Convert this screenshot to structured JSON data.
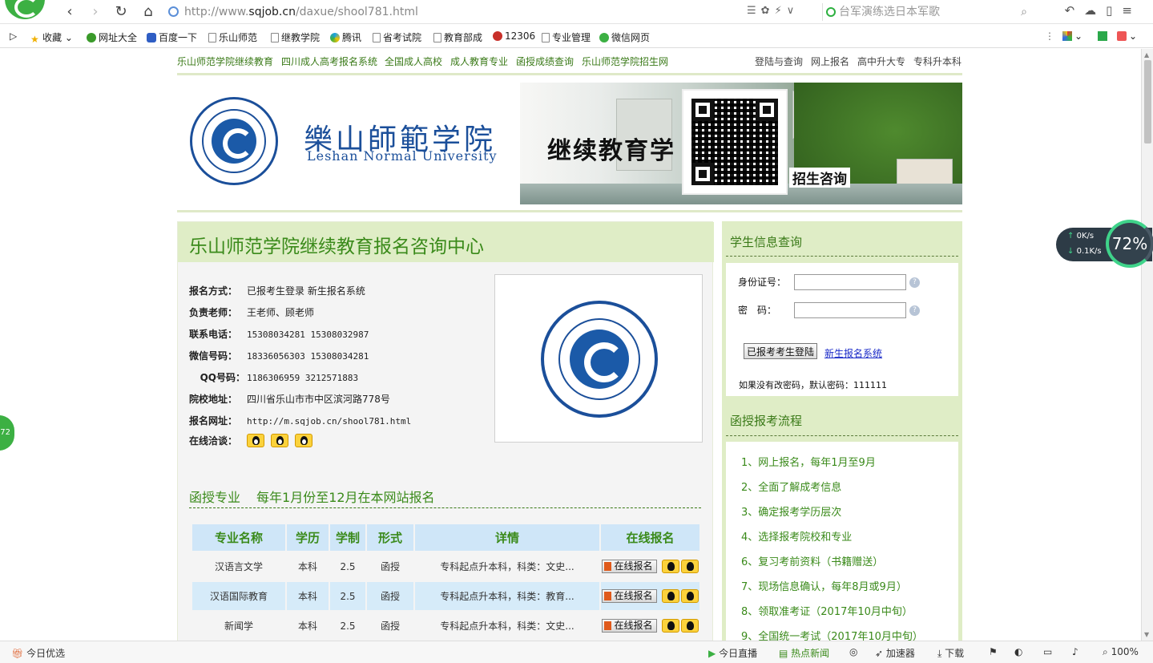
{
  "browser": {
    "url_prefix": "http://www.",
    "url_host": "sqjob.cn",
    "url_path": "/daxue/shool781.html",
    "search_placeholder": "台军演练选日本军歌",
    "icons": [
      "back-icon",
      "forward-icon",
      "refresh-icon",
      "home-icon"
    ]
  },
  "bookmarks": [
    {
      "label": "收藏",
      "icon": "star-icon"
    },
    {
      "label": "网址大全",
      "icon": "globe-icon"
    },
    {
      "label": "百度一下",
      "icon": "paw-icon"
    },
    {
      "label": "乐山师范",
      "icon": "page-icon"
    },
    {
      "label": "继教学院",
      "icon": "page-icon"
    },
    {
      "label": "腾讯",
      "icon": "tencent-icon"
    },
    {
      "label": "省考试院",
      "icon": "page-icon"
    },
    {
      "label": "教育部成",
      "icon": "page-icon"
    },
    {
      "label": "12306",
      "icon": "train-icon"
    },
    {
      "label": "专业管理",
      "icon": "page-icon"
    },
    {
      "label": "微信网页",
      "icon": "wechat-icon"
    }
  ],
  "top_nav": {
    "left": [
      "乐山师范学院继续教育",
      "四川成人高考报名系统",
      "全国成人高校",
      "成人教育专业",
      "函授成绩查询",
      "乐山师范学院招生网"
    ],
    "right": [
      "登陆与查询",
      "网上报名",
      "高中升大专",
      "专科升本科"
    ]
  },
  "banner": {
    "name_cn": "樂山師範学院",
    "name_en": "Leshan Normal University",
    "slogan": "继续教育学",
    "consult": "招生咨询"
  },
  "main": {
    "title": "乐山师范学院继续教育报名咨询中心",
    "info": [
      {
        "label": "报名方式：",
        "value": "已报考生登录  新生报名系统"
      },
      {
        "label": "负责老师：",
        "value": "王老师、顾老师"
      },
      {
        "label": "联系电话：",
        "value": "15308034281 15308032987"
      },
      {
        "label": "微信号码：",
        "value": "18336056303 15308034281"
      },
      {
        "label": "QQ号码：",
        "value": "1186306959 3212571883"
      },
      {
        "label": "院校地址：",
        "value": "四川省乐山市市中区滨河路778号"
      },
      {
        "label": "报名网址：",
        "value": "http://m.sqjob.cn/shool781.html"
      },
      {
        "label": "在线洽谈：",
        "value": ""
      }
    ],
    "majors_heading": "函授专业",
    "majors_sub": "每年1月份至12月在本网站报名",
    "table_headers": [
      "专业名称",
      "学历",
      "学制",
      "形式",
      "详情",
      "在线报名"
    ],
    "rows": [
      {
        "name": "汉语言文学",
        "level": "本科",
        "years": "2.5",
        "form": "函授",
        "detail": "专科起点升本科，科类：文史..."
      },
      {
        "name": "汉语国际教育",
        "level": "本科",
        "years": "2.5",
        "form": "函授",
        "detail": "专科起点升本科，科类：教育..."
      },
      {
        "name": "新闻学",
        "level": "本科",
        "years": "2.5",
        "form": "函授",
        "detail": "专科起点升本科，科类：文史..."
      }
    ],
    "register_label": "在线报名"
  },
  "side": {
    "student_title": "学生信息查询",
    "id_label": "身份证号：",
    "pw_label": "密　码：",
    "login_button": "已报考考生登陆",
    "new_link": "新生报名系统",
    "default_pw": "如果没有改密码，默认密码：111111",
    "process_title": "函授报考流程",
    "steps": [
      "1、网上报名，每年1月至9月",
      "2、全面了解成考信息",
      "3、确定报考学历层次",
      "4、选择报考院校和专业",
      "6、复习考前资料（书籍赠送）",
      "7、现场信息确认，每年8月或9月）",
      "8、领取准考证（2017年10月中旬）",
      "9、全国统一考试（2017年10月中旬）"
    ]
  },
  "speed": {
    "up": "0K/s",
    "down": "0.1K/s",
    "percent": "72%"
  },
  "side_float": "72",
  "status": {
    "left": "今日优选",
    "items": [
      "今日直播",
      "热点新闻",
      "加速器",
      "下载",
      "100%"
    ]
  }
}
